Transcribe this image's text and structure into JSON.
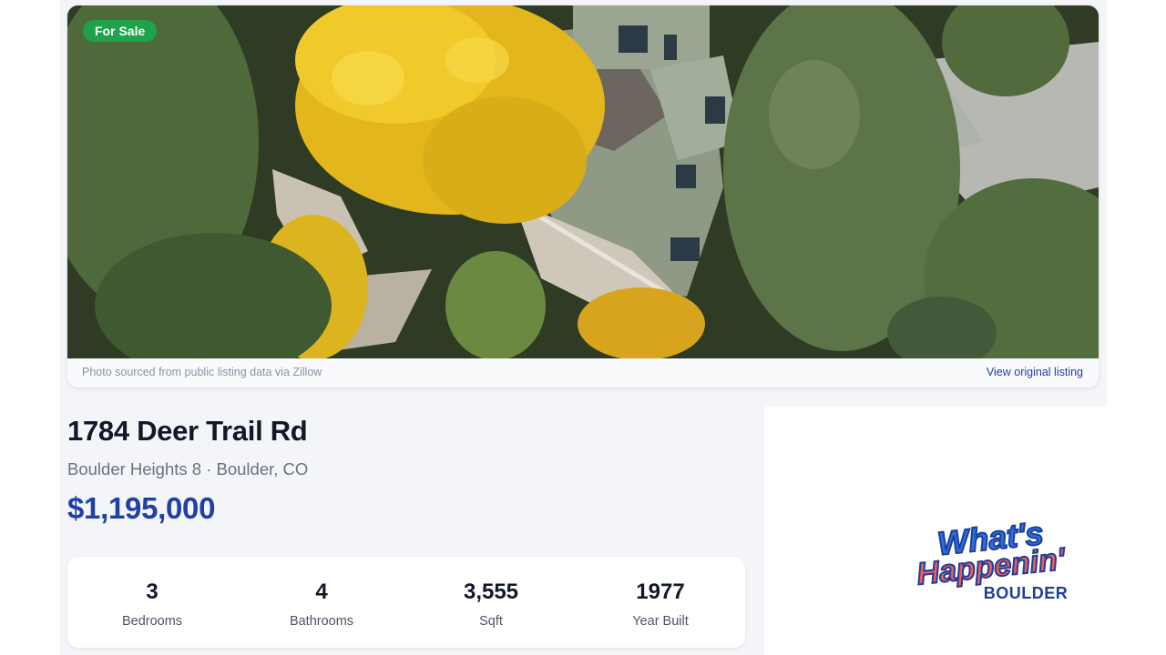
{
  "listing": {
    "status_badge": "For Sale",
    "photo": {
      "caption": "Photo sourced from public listing data via Zillow",
      "link_label": "View original listing"
    },
    "address": "1784 Deer Trail Rd",
    "locality": "Boulder Heights 8 · Boulder, CO",
    "price": "$1,195,000",
    "stats": [
      {
        "value": "3",
        "label": "Bedrooms"
      },
      {
        "value": "4",
        "label": "Bathrooms"
      },
      {
        "value": "3,555",
        "label": "Sqft"
      },
      {
        "value": "1977",
        "label": "Year Built"
      }
    ]
  },
  "brand": {
    "line1": "What's",
    "line2": "Happenin'",
    "line3": "BOULDER"
  },
  "colors": {
    "badge": "#1ea34a",
    "price": "#2140a6",
    "link": "#1f3fa8",
    "logo_blue": "#2a6fe0",
    "logo_red": "#f05a5a",
    "logo_navy": "#1d3f9a"
  }
}
